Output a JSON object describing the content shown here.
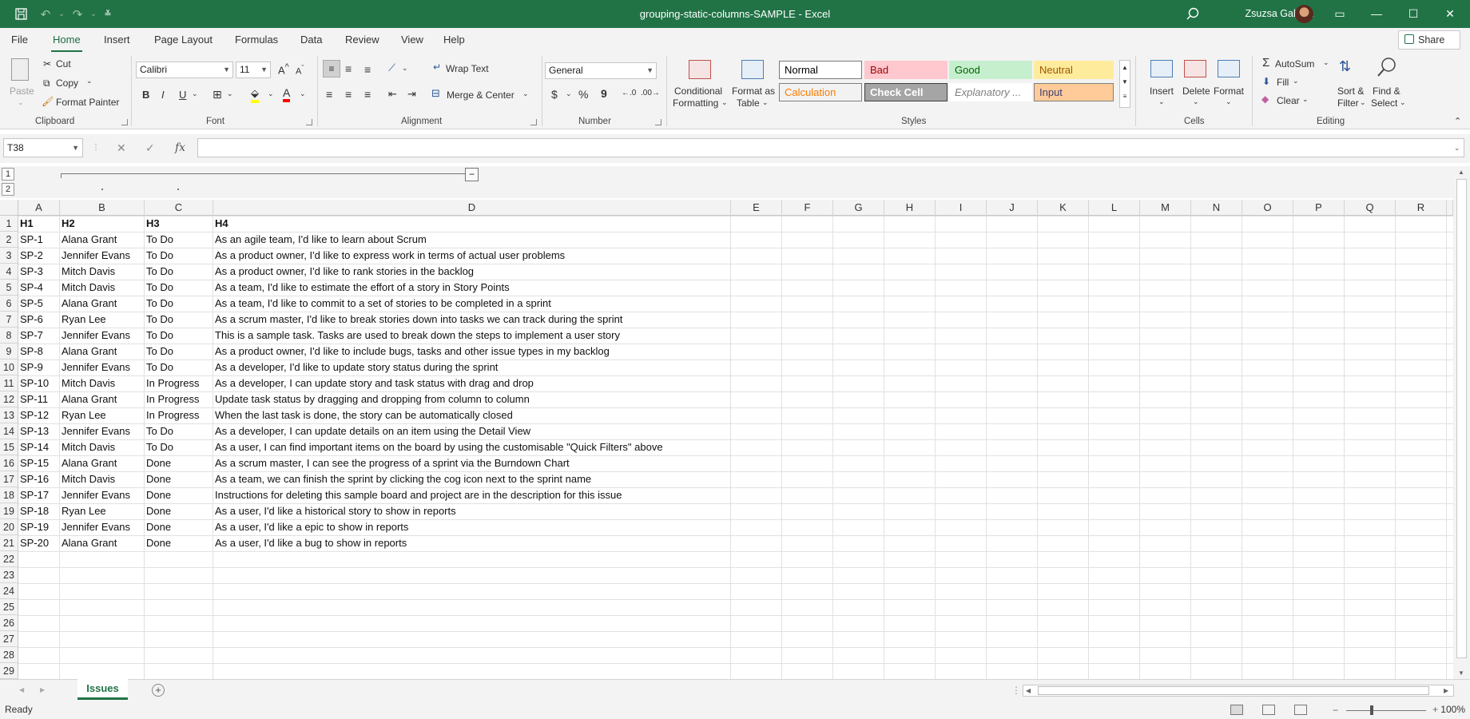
{
  "window": {
    "title": "grouping-static-columns-SAMPLE  -  Excel",
    "user": "Zsuzsa Galicza"
  },
  "menu": {
    "tabs": [
      "File",
      "Home",
      "Insert",
      "Page Layout",
      "Formulas",
      "Data",
      "Review",
      "View",
      "Help"
    ],
    "active": "Home",
    "share": "Share"
  },
  "ribbon": {
    "clipboard": {
      "paste": "Paste",
      "cut": "Cut",
      "copy": "Copy",
      "format_painter": "Format Painter",
      "label": "Clipboard"
    },
    "font": {
      "name": "Calibri",
      "size": "11",
      "bold": "B",
      "italic": "I",
      "underline": "U",
      "label": "Font"
    },
    "alignment": {
      "wrap": "Wrap Text",
      "merge": "Merge & Center",
      "label": "Alignment"
    },
    "number": {
      "format": "General",
      "currency": "$",
      "percent": "%",
      "comma": "9",
      "label": "Number"
    },
    "styles": {
      "conditional": "Conditional",
      "conditional2": "Formatting",
      "format_as": "Format as",
      "format_as2": "Table",
      "label": "Styles",
      "cells": [
        {
          "name": "Normal",
          "bg": "#ffffff",
          "fg": "#000000",
          "border": "#7a7a7a"
        },
        {
          "name": "Bad",
          "bg": "#ffc7ce",
          "fg": "#9c0006",
          "border": "#ffc7ce"
        },
        {
          "name": "Good",
          "bg": "#c6efce",
          "fg": "#006100",
          "border": "#c6efce"
        },
        {
          "name": "Neutral",
          "bg": "#ffeb9c",
          "fg": "#9c5700",
          "border": "#ffeb9c"
        },
        {
          "name": "Calculation",
          "bg": "#f2f2f2",
          "fg": "#fa7d00",
          "border": "#7f7f7f"
        },
        {
          "name": "Check Cell",
          "bg": "#a5a5a5",
          "fg": "#ffffff",
          "border": "#3f3f3f"
        },
        {
          "name": "Explanatory ...",
          "bg": "#ffffff",
          "fg": "#7f7f7f",
          "border": "#ffffff"
        },
        {
          "name": "Input",
          "bg": "#ffcc99",
          "fg": "#3f3f76",
          "border": "#7f7f7f"
        }
      ]
    },
    "cells": {
      "insert": "Insert",
      "delete": "Delete",
      "format": "Format",
      "label": "Cells"
    },
    "editing": {
      "autosum": "AutoSum",
      "fill": "Fill",
      "clear": "Clear",
      "sort": "Sort &",
      "sort2": "Filter",
      "find": "Find &",
      "find2": "Select",
      "label": "Editing"
    }
  },
  "formula_bar": {
    "name_box": "T38",
    "fx": "fx",
    "value": ""
  },
  "outline": {
    "level1": "1",
    "level2": "2",
    "collapse": "−"
  },
  "grid": {
    "columns": [
      "A",
      "B",
      "C",
      "D",
      "E",
      "F",
      "G",
      "H",
      "I",
      "J",
      "K",
      "L",
      "M",
      "N",
      "O",
      "P",
      "Q",
      "R"
    ],
    "row_numbers": [
      "1",
      "2",
      "3",
      "4",
      "5",
      "6",
      "7",
      "8",
      "9",
      "10",
      "11",
      "12",
      "13",
      "14",
      "15",
      "16",
      "17",
      "18",
      "19",
      "20",
      "21",
      "22",
      "23",
      "24",
      "25",
      "26",
      "27",
      "28",
      "29"
    ],
    "rows": [
      [
        "H1",
        "H2",
        "H3",
        "H4"
      ],
      [
        "SP-1",
        "Alana Grant",
        "To Do",
        "As an agile team, I'd like to learn about Scrum"
      ],
      [
        "SP-2",
        "Jennifer Evans",
        "To Do",
        "As a product owner, I'd like to express work in terms of actual user problems"
      ],
      [
        "SP-3",
        "Mitch Davis",
        "To Do",
        "As a product owner, I'd like to rank stories in the backlog"
      ],
      [
        "SP-4",
        "Mitch Davis",
        "To Do",
        "As a team, I'd like to estimate the effort of a story in Story Points"
      ],
      [
        "SP-5",
        "Alana Grant",
        "To Do",
        "As a team, I'd like to commit to a set of stories to be completed in a sprint"
      ],
      [
        "SP-6",
        "Ryan Lee",
        "To Do",
        "As a scrum master, I'd like to break stories down into tasks we can track during the sprint"
      ],
      [
        "SP-7",
        "Jennifer Evans",
        "To Do",
        "This is a sample task. Tasks are used to break down the steps to implement a user story"
      ],
      [
        "SP-8",
        "Alana Grant",
        "To Do",
        "As a product owner, I'd like to include bugs, tasks and other issue types in my backlog"
      ],
      [
        "SP-9",
        "Jennifer Evans",
        "To Do",
        "As a developer, I'd like to update story status during the sprint"
      ],
      [
        "SP-10",
        "Mitch Davis",
        "In Progress",
        "As a developer, I can update story and task status with drag and drop"
      ],
      [
        "SP-11",
        "Alana Grant",
        "In Progress",
        "Update task status by dragging and dropping from column to column"
      ],
      [
        "SP-12",
        "Ryan Lee",
        "In Progress",
        "When the last task is done, the story can be automatically closed"
      ],
      [
        "SP-13",
        "Jennifer Evans",
        "To Do",
        "As a developer, I can update details on an item using the Detail View"
      ],
      [
        "SP-14",
        "Mitch Davis",
        "To Do",
        "As a user, I can find important items on the board by using the customisable \"Quick Filters\" above"
      ],
      [
        "SP-15",
        "Alana Grant",
        "Done",
        "As a scrum master, I can see the progress of a sprint via the Burndown Chart"
      ],
      [
        "SP-16",
        "Mitch Davis",
        "Done",
        "As a team, we can finish the sprint by clicking the cog icon next to the sprint name"
      ],
      [
        "SP-17",
        "Jennifer Evans",
        "Done",
        "Instructions for deleting this sample board and project are in the description for this issue"
      ],
      [
        "SP-18",
        "Ryan Lee",
        "Done",
        "As a user, I'd like a historical story to show in reports"
      ],
      [
        "SP-19",
        "Jennifer Evans",
        "Done",
        "As a user, I'd like a epic to show in reports"
      ],
      [
        "SP-20",
        "Alana Grant",
        "Done",
        "As a user, I'd like a bug to show in reports"
      ]
    ]
  },
  "sheets": {
    "active": "Issues"
  },
  "status": {
    "ready": "Ready",
    "zoom": "100%"
  }
}
